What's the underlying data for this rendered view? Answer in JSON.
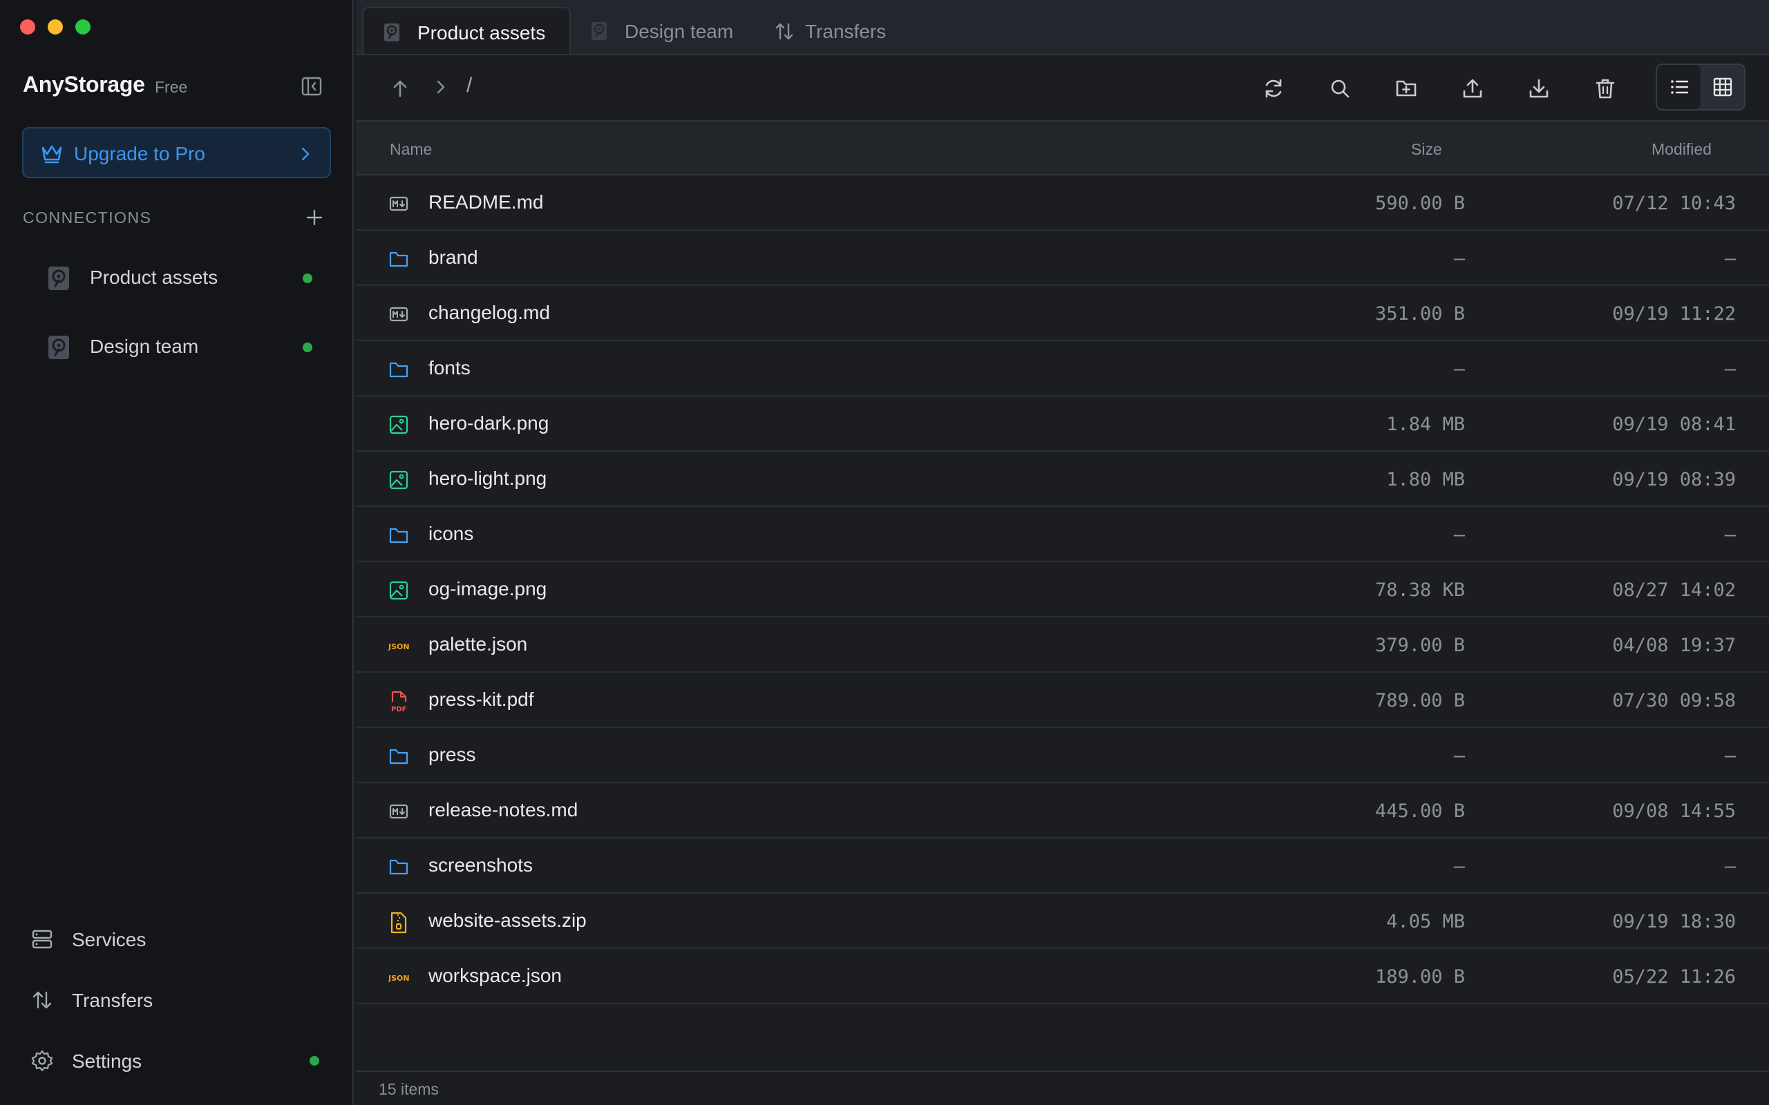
{
  "window": {
    "buttons": [
      "close",
      "minimize",
      "zoom"
    ]
  },
  "sidebar": {
    "app_name": "AnyStorage",
    "plan": "Free",
    "upgrade_label": "Upgrade to Pro",
    "connections_heading": "CONNECTIONS",
    "connections": [
      {
        "label": "Product assets",
        "status": "connected"
      },
      {
        "label": "Design team",
        "status": "connected"
      }
    ],
    "nav": {
      "services": "Services",
      "transfers": "Transfers",
      "settings": "Settings"
    }
  },
  "tabs": [
    {
      "label": "Product assets",
      "active": true,
      "icon": "drive-icon"
    },
    {
      "label": "Design team",
      "active": false,
      "icon": "drive-icon"
    },
    {
      "label": "Transfers",
      "active": false,
      "icon": "transfer-icon"
    }
  ],
  "toolbar": {
    "path_root": "/",
    "view_mode": "list"
  },
  "table": {
    "headers": {
      "name": "Name",
      "size": "Size",
      "modified": "Modified"
    },
    "rows": [
      {
        "name": "README.md",
        "type": "markdown",
        "size": "590.00 B",
        "modified": "07/12 10:43"
      },
      {
        "name": "brand",
        "type": "folder",
        "size": "–",
        "modified": "–"
      },
      {
        "name": "changelog.md",
        "type": "markdown",
        "size": "351.00 B",
        "modified": "09/19 11:22"
      },
      {
        "name": "fonts",
        "type": "folder",
        "size": "–",
        "modified": "–"
      },
      {
        "name": "hero-dark.png",
        "type": "image",
        "size": "1.84 MB",
        "modified": "09/19 08:41"
      },
      {
        "name": "hero-light.png",
        "type": "image",
        "size": "1.80 MB",
        "modified": "09/19 08:39"
      },
      {
        "name": "icons",
        "type": "folder",
        "size": "–",
        "modified": "–"
      },
      {
        "name": "og-image.png",
        "type": "image",
        "size": "78.38 KB",
        "modified": "08/27 14:02"
      },
      {
        "name": "palette.json",
        "type": "json",
        "size": "379.00 B",
        "modified": "04/08 19:37"
      },
      {
        "name": "press-kit.pdf",
        "type": "pdf",
        "size": "789.00 B",
        "modified": "07/30 09:58"
      },
      {
        "name": "press",
        "type": "folder",
        "size": "–",
        "modified": "–"
      },
      {
        "name": "release-notes.md",
        "type": "markdown",
        "size": "445.00 B",
        "modified": "09/08 14:55"
      },
      {
        "name": "screenshots",
        "type": "folder",
        "size": "–",
        "modified": "–"
      },
      {
        "name": "website-assets.zip",
        "type": "zip",
        "size": "4.05 MB",
        "modified": "09/19 18:30"
      },
      {
        "name": "workspace.json",
        "type": "json",
        "size": "189.00 B",
        "modified": "05/22 11:26"
      }
    ]
  },
  "status": {
    "items_count": "15 items"
  },
  "colors": {
    "accent": "#3d95f0",
    "folder": "#4a9ff5",
    "image": "#2fcf95",
    "json": "#f0a21c",
    "pdf": "#f2564f",
    "zip": "#f0b429",
    "online": "#2ea84a"
  }
}
